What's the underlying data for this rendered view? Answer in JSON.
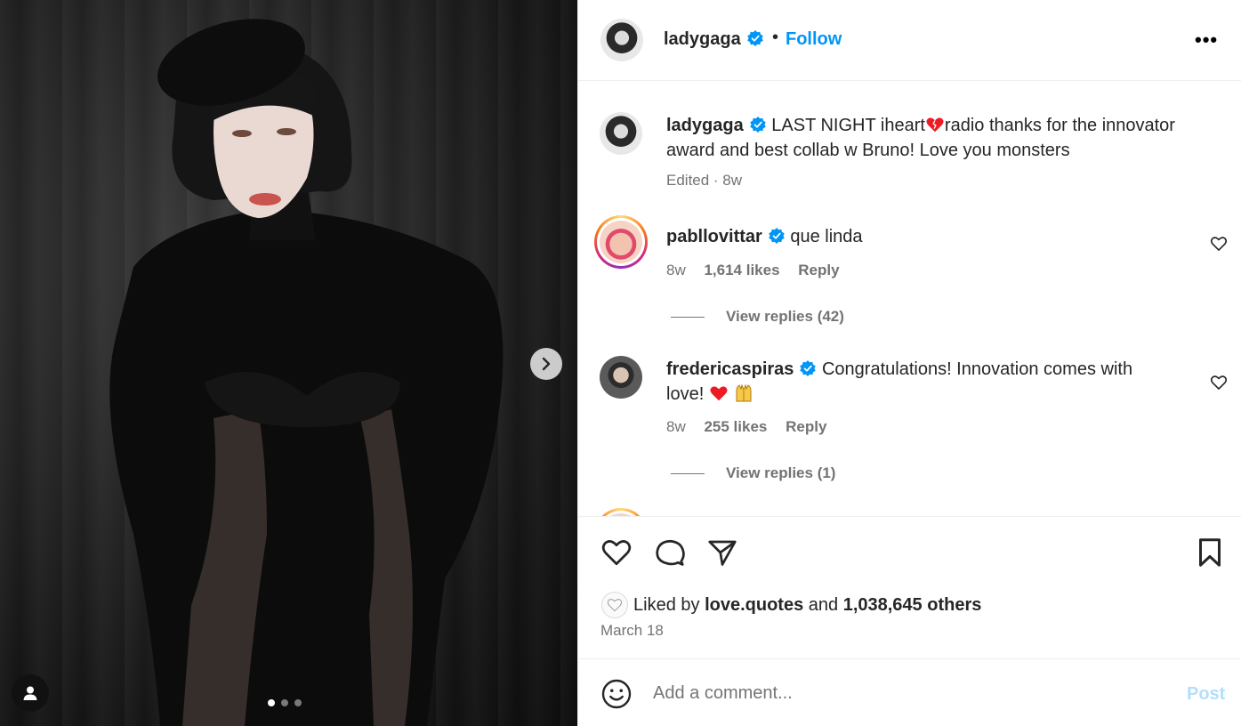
{
  "colors": {
    "link": "#0095f6",
    "secondary_text": "#737373",
    "primary_text": "#262626",
    "post_disabled": "#b2dffc",
    "heart_red": "#ed1c24"
  },
  "media": {
    "carousel_next_icon": "chevron-right-icon",
    "tagged_icon": "person-icon",
    "dots": {
      "count": 3,
      "active_index": 0
    }
  },
  "header": {
    "username": "ladygaga",
    "separator": "•",
    "follow_label": "Follow",
    "more_icon": "more-horizontal-icon",
    "more_label": "•••"
  },
  "caption": {
    "username": "ladygaga",
    "text_part1": "LAST NIGHT iheart",
    "text_part2": "radio thanks for the innovator award and best collab w Bruno! Love you monsters",
    "meta": "Edited · 8w"
  },
  "comments": [
    {
      "username": "pabllovittar",
      "text": "que linda",
      "time": "8w",
      "likes": "1,614 likes",
      "reply_label": "Reply",
      "view_replies": "View replies (42)"
    },
    {
      "username": "fredericaspiras",
      "text": "Congratulations! Innovation comes with love!",
      "time": "8w",
      "likes": "255 likes",
      "reply_label": "Reply",
      "view_replies": "View replies (1)"
    }
  ],
  "actions": {
    "like_icon": "heart-icon",
    "comment_icon": "comment-icon",
    "share_icon": "send-icon",
    "save_icon": "bookmark-icon"
  },
  "likes": {
    "prefix": "Liked by",
    "user": "love.quotes",
    "middle": "and",
    "others": "1,038,645 others"
  },
  "date": "March 18",
  "composer": {
    "emoji_icon": "smiley-icon",
    "placeholder": "Add a comment...",
    "post_label": "Post"
  }
}
